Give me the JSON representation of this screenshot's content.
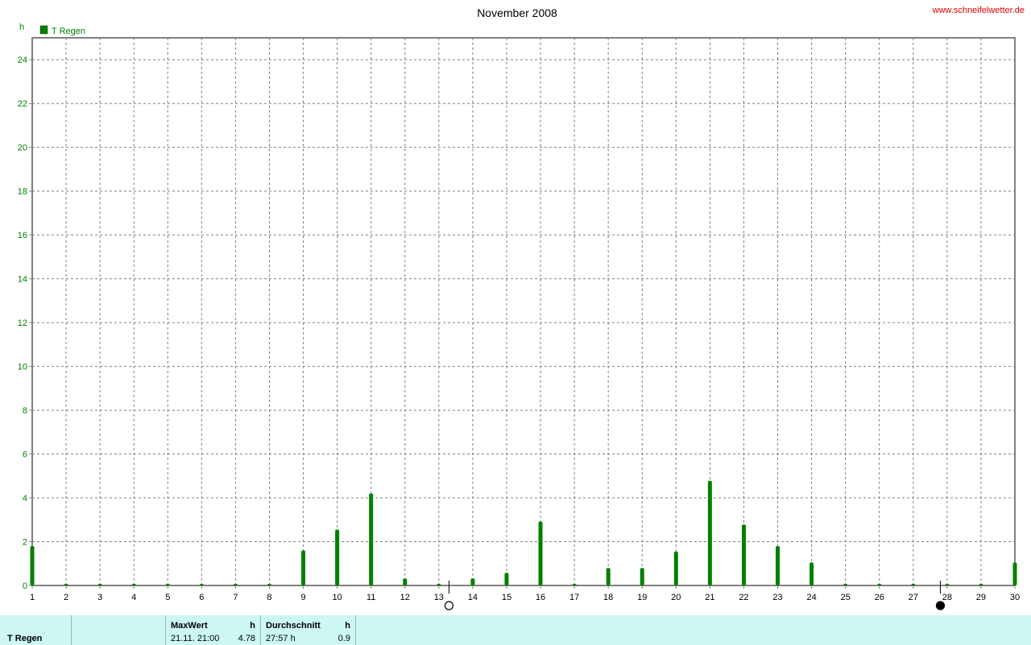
{
  "site": "www.schneifelwetter.de",
  "chart_data": {
    "type": "bar",
    "title": "November 2008",
    "ylabel": "h",
    "xlabel": "",
    "ylim": [
      0,
      25
    ],
    "yticks": [
      0,
      2,
      4,
      6,
      8,
      10,
      12,
      14,
      16,
      18,
      20,
      22,
      24
    ],
    "categories": [
      "1",
      "2",
      "3",
      "4",
      "5",
      "6",
      "7",
      "8",
      "9",
      "10",
      "11",
      "12",
      "13",
      "14",
      "15",
      "16",
      "17",
      "18",
      "19",
      "20",
      "21",
      "22",
      "23",
      "24",
      "25",
      "26",
      "27",
      "28",
      "29",
      "30"
    ],
    "series": [
      {
        "name": "T Regen",
        "color": "#008000",
        "values": [
          1.8,
          0,
          0,
          0,
          0,
          0,
          0,
          0,
          1.6,
          2.55,
          4.2,
          0.32,
          0,
          0.32,
          0.58,
          2.92,
          0,
          0.8,
          0.8,
          1.55,
          4.78,
          2.78,
          1.8,
          1.05,
          0,
          0,
          0,
          0,
          0,
          1.05
        ]
      }
    ],
    "grid": true,
    "legend": "top-left",
    "moon_phases": [
      {
        "day": 13.3,
        "phase": "full-moon"
      },
      {
        "day": 27.8,
        "phase": "new-moon"
      }
    ]
  },
  "footer": {
    "series_name": "T Regen",
    "max_header": "MaxWert",
    "max_unit": "h",
    "max_time": "21.11.  21:00",
    "max_value": "4.78",
    "avg_header": "Durchschnitt",
    "avg_unit": "h",
    "avg_total": "27:57 h",
    "avg_value": "0.9"
  }
}
